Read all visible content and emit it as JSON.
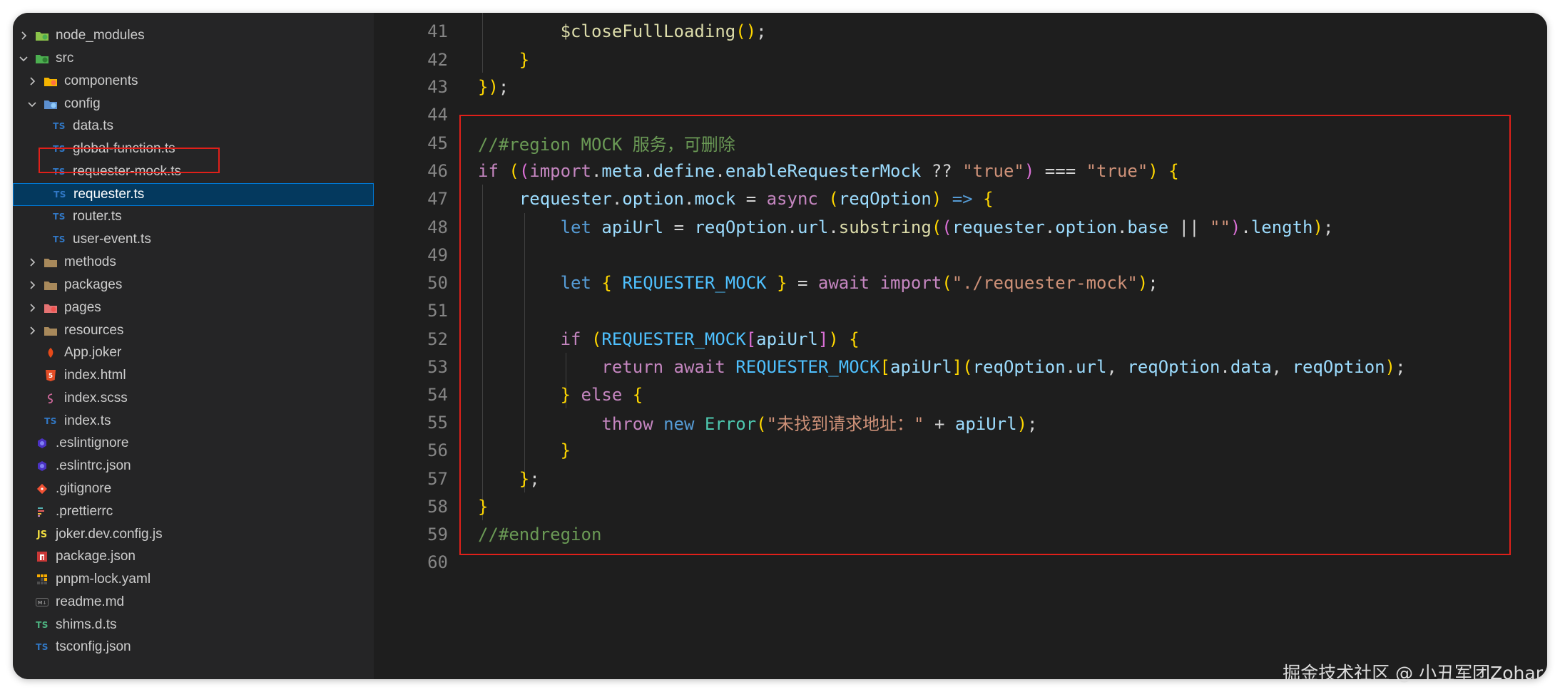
{
  "explorer": {
    "items": [
      {
        "label": "node_modules",
        "type": "folder",
        "icon": "node-modules-folder-icon",
        "expanded": false
      },
      {
        "label": "src",
        "type": "folder",
        "icon": "src-folder-icon",
        "expanded": true
      },
      {
        "label": "components",
        "type": "folder",
        "icon": "components-folder-icon",
        "expanded": false
      },
      {
        "label": "config",
        "type": "folder",
        "icon": "config-folder-icon",
        "expanded": true
      },
      {
        "label": "data.ts",
        "type": "file",
        "icon": "typescript-file-icon"
      },
      {
        "label": "global-function.ts",
        "type": "file",
        "icon": "typescript-file-icon"
      },
      {
        "label": "requester-mock.ts",
        "type": "file",
        "icon": "typescript-file-icon",
        "highlighted": true
      },
      {
        "label": "requester.ts",
        "type": "file",
        "icon": "typescript-file-icon",
        "selected": true
      },
      {
        "label": "router.ts",
        "type": "file",
        "icon": "typescript-file-icon"
      },
      {
        "label": "user-event.ts",
        "type": "file",
        "icon": "typescript-file-icon"
      },
      {
        "label": "methods",
        "type": "folder",
        "icon": "methods-folder-icon",
        "expanded": false
      },
      {
        "label": "packages",
        "type": "folder",
        "icon": "packages-folder-icon",
        "expanded": false
      },
      {
        "label": "pages",
        "type": "folder",
        "icon": "pages-folder-icon",
        "expanded": false
      },
      {
        "label": "resources",
        "type": "folder",
        "icon": "resources-folder-icon",
        "expanded": false
      },
      {
        "label": "App.joker",
        "type": "file",
        "icon": "joker-file-icon"
      },
      {
        "label": "index.html",
        "type": "file",
        "icon": "html-file-icon"
      },
      {
        "label": "index.scss",
        "type": "file",
        "icon": "scss-file-icon"
      },
      {
        "label": "index.ts",
        "type": "file",
        "icon": "typescript-file-icon"
      },
      {
        "label": ".eslintignore",
        "type": "file",
        "icon": "eslint-file-icon"
      },
      {
        "label": ".eslintrc.json",
        "type": "file",
        "icon": "eslint-file-icon"
      },
      {
        "label": ".gitignore",
        "type": "file",
        "icon": "git-file-icon"
      },
      {
        "label": ".prettierrc",
        "type": "file",
        "icon": "prettier-file-icon"
      },
      {
        "label": "joker.dev.config.js",
        "type": "file",
        "icon": "javascript-file-icon"
      },
      {
        "label": "package.json",
        "type": "file",
        "icon": "npm-file-icon"
      },
      {
        "label": "pnpm-lock.yaml",
        "type": "file",
        "icon": "pnpm-file-icon"
      },
      {
        "label": "readme.md",
        "type": "file",
        "icon": "markdown-file-icon"
      },
      {
        "label": "shims.d.ts",
        "type": "file",
        "icon": "typescript-definition-file-icon"
      },
      {
        "label": "tsconfig.json",
        "type": "file",
        "icon": "tsconfig-file-icon"
      }
    ],
    "icon_texts": {
      "ts": "TS",
      "js": "JS"
    }
  },
  "editor": {
    "lines": [
      {
        "num": "41",
        "text": "        $closeFullLoading();"
      },
      {
        "num": "42",
        "text": "    }"
      },
      {
        "num": "43",
        "text": "});"
      },
      {
        "num": "44",
        "text": ""
      },
      {
        "num": "45",
        "text": "//#region MOCK 服务，可删除"
      },
      {
        "num": "46",
        "text": "if ((import.meta.define.enableRequesterMock ?? \"true\") === \"true\") {"
      },
      {
        "num": "47",
        "text": "    requester.option.mock = async (reqOption) => {"
      },
      {
        "num": "48",
        "text": "        let apiUrl = reqOption.url.substring((requester.option.base || \"\").length);"
      },
      {
        "num": "49",
        "text": ""
      },
      {
        "num": "50",
        "text": "        let { REQUESTER_MOCK } = await import(\"./requester-mock\");"
      },
      {
        "num": "51",
        "text": ""
      },
      {
        "num": "52",
        "text": "        if (REQUESTER_MOCK[apiUrl]) {"
      },
      {
        "num": "53",
        "text": "            return await REQUESTER_MOCK[apiUrl](reqOption.url, reqOption.data, reqOption);"
      },
      {
        "num": "54",
        "text": "        } else {"
      },
      {
        "num": "55",
        "text": "            throw new Error(\"未找到请求地址：\" + apiUrl);"
      },
      {
        "num": "56",
        "text": "        }"
      },
      {
        "num": "57",
        "text": "    };"
      },
      {
        "num": "58",
        "text": "}"
      },
      {
        "num": "59",
        "text": "//#endregion"
      },
      {
        "num": "60",
        "text": ""
      }
    ]
  },
  "colors": {
    "highlight_box": "#e0201a",
    "selection": "#04395e",
    "editor_bg": "#1e1e1e",
    "sidebar_bg": "#252526"
  },
  "watermark": "掘金技术社区 @ 小丑军团Zohar"
}
